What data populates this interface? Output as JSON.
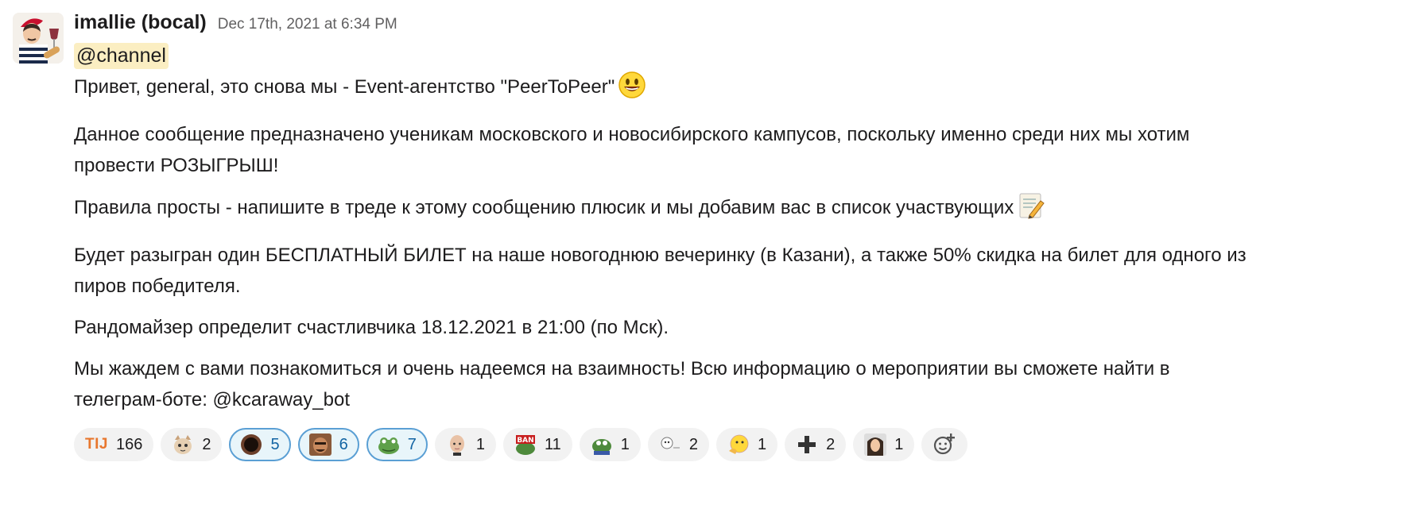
{
  "message": {
    "author": "imallie (bocal)",
    "timestamp": "Dec 17th, 2021 at 6:34 PM",
    "mention": "@channel",
    "paragraphs": [
      "Привет, general, это снова мы - Event-агентство \"PeerToPeer\"",
      "Данное сообщение предназначено ученикам московского и новосибирского кампусов, поскольку именно среди них мы хотим провести РОЗЫГРЫШ!",
      "Правила просты - напишите в треде к этому сообщению плюсик и мы добавим вас в список участвующих",
      "Будет разыгран один БЕСПЛАТНЫЙ БИЛЕТ на наше новогоднюю вечеринку (в Казани), а также 50% скидка на билет для одного из пиров победителя.",
      "Рандомайзер определит счастливчика 18.12.2021 в 21:00 (по Мск).",
      "Мы жаждем с вами познакомиться и очень надеемся на взаимность! Всю информацию о мероприятии вы сможете найти в телеграм-боте: @kcaraway_bot"
    ]
  },
  "reactions": [
    {
      "label": "TIJ",
      "count": "166",
      "active": false,
      "icon": "tij-text-icon"
    },
    {
      "count": "2",
      "active": false,
      "icon": "cat-face-icon"
    },
    {
      "count": "5",
      "active": true,
      "icon": "dark-hole-icon"
    },
    {
      "count": "6",
      "active": true,
      "icon": "man-face-icon"
    },
    {
      "count": "7",
      "active": true,
      "icon": "frog-icon"
    },
    {
      "count": "1",
      "active": false,
      "icon": "bald-head-icon"
    },
    {
      "count": "11",
      "active": false,
      "icon": "ban-frog-icon"
    },
    {
      "count": "1",
      "active": false,
      "icon": "pepe-frog-icon"
    },
    {
      "count": "2",
      "active": false,
      "icon": "meme-face-icon"
    },
    {
      "count": "1",
      "active": false,
      "icon": "thinking-face-icon"
    },
    {
      "count": "2",
      "active": false,
      "icon": "heavy-plus-icon"
    },
    {
      "count": "1",
      "active": false,
      "icon": "girl-photo-icon"
    }
  ],
  "add_reaction_icon": "add-reaction-icon",
  "colors": {
    "accent": "#1264a3",
    "mention_bg": "#fbeec2",
    "tij": "#e8772e"
  }
}
